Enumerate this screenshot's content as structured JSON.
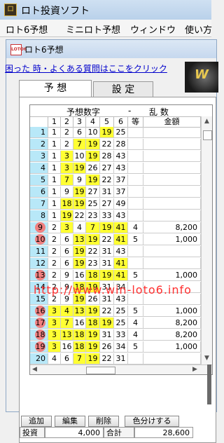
{
  "app": {
    "title": "ロト投資ソフト",
    "icon_label": "ロ"
  },
  "menu": [
    "ロト6予想",
    "ミニロト予想",
    "ウィンドウ",
    "使い方"
  ],
  "child": {
    "title": "ロト6予想",
    "icon_label": "LOTO6"
  },
  "help_link": "困った 時・よくある質問はここをクリック",
  "banner_text": "W",
  "tabs": [
    "予 想",
    "設 定"
  ],
  "grid": {
    "header_title": "予想数字",
    "header_dash": "-",
    "header_mode": "乱 数",
    "columns": [
      "",
      "1",
      "2",
      "3",
      "4",
      "5",
      "6",
      "等",
      "金額"
    ],
    "rows": [
      {
        "idx": "1",
        "n": [
          "1",
          "2",
          "6",
          "10",
          "19",
          "25"
        ],
        "hl": [
          0,
          0,
          0,
          0,
          1,
          0
        ],
        "rank": "",
        "amount": "",
        "circle": false
      },
      {
        "idx": "2",
        "n": [
          "1",
          "2",
          "7",
          "19",
          "22",
          "28"
        ],
        "hl": [
          0,
          0,
          1,
          1,
          0,
          0
        ],
        "rank": "",
        "amount": "",
        "circle": false
      },
      {
        "idx": "3",
        "n": [
          "1",
          "3",
          "10",
          "19",
          "28",
          "43"
        ],
        "hl": [
          0,
          1,
          0,
          1,
          0,
          0
        ],
        "rank": "",
        "amount": "",
        "circle": false
      },
      {
        "idx": "4",
        "n": [
          "1",
          "3",
          "19",
          "26",
          "27",
          "43"
        ],
        "hl": [
          0,
          1,
          1,
          0,
          0,
          0
        ],
        "rank": "",
        "amount": "",
        "circle": false
      },
      {
        "idx": "5",
        "n": [
          "1",
          "7",
          "9",
          "19",
          "22",
          "37"
        ],
        "hl": [
          0,
          1,
          0,
          1,
          0,
          0
        ],
        "rank": "",
        "amount": "",
        "circle": false
      },
      {
        "idx": "6",
        "n": [
          "1",
          "9",
          "19",
          "27",
          "31",
          "37"
        ],
        "hl": [
          0,
          0,
          1,
          0,
          0,
          0
        ],
        "rank": "",
        "amount": "",
        "circle": false
      },
      {
        "idx": "7",
        "n": [
          "1",
          "18",
          "19",
          "25",
          "27",
          "49"
        ],
        "hl": [
          0,
          1,
          1,
          0,
          0,
          0
        ],
        "rank": "",
        "amount": "",
        "circle": false
      },
      {
        "idx": "8",
        "n": [
          "1",
          "19",
          "22",
          "23",
          "33",
          "43"
        ],
        "hl": [
          0,
          1,
          0,
          0,
          0,
          0
        ],
        "rank": "",
        "amount": "",
        "circle": false
      },
      {
        "idx": "9",
        "n": [
          "2",
          "3",
          "4",
          "7",
          "19",
          "41"
        ],
        "hl": [
          0,
          1,
          0,
          1,
          1,
          1
        ],
        "rank": "4",
        "amount": "8,200",
        "circle": true
      },
      {
        "idx": "10",
        "n": [
          "2",
          "6",
          "13",
          "19",
          "22",
          "41"
        ],
        "hl": [
          0,
          0,
          1,
          1,
          0,
          1
        ],
        "rank": "5",
        "amount": "1,000",
        "circle": true
      },
      {
        "idx": "11",
        "n": [
          "2",
          "6",
          "19",
          "22",
          "31",
          "43"
        ],
        "hl": [
          0,
          0,
          1,
          0,
          0,
          0
        ],
        "rank": "",
        "amount": "",
        "circle": false
      },
      {
        "idx": "12",
        "n": [
          "2",
          "6",
          "19",
          "23",
          "31",
          "41"
        ],
        "hl": [
          0,
          0,
          1,
          0,
          0,
          1
        ],
        "rank": "",
        "amount": "",
        "circle": false
      },
      {
        "idx": "13",
        "n": [
          "2",
          "9",
          "16",
          "18",
          "19",
          "41"
        ],
        "hl": [
          0,
          0,
          0,
          1,
          1,
          1
        ],
        "rank": "5",
        "amount": "1,000",
        "circle": true
      },
      {
        "idx": "14",
        "n": [
          "2",
          "9",
          "18",
          "19",
          "31",
          "34"
        ],
        "hl": [
          0,
          0,
          1,
          1,
          0,
          0
        ],
        "rank": "",
        "amount": "",
        "circle": false
      },
      {
        "idx": "15",
        "n": [
          "2",
          "9",
          "19",
          "26",
          "31",
          "43"
        ],
        "hl": [
          0,
          0,
          1,
          0,
          0,
          0
        ],
        "rank": "",
        "amount": "",
        "circle": false
      },
      {
        "idx": "16",
        "n": [
          "3",
          "4",
          "13",
          "19",
          "22",
          "25"
        ],
        "hl": [
          1,
          1,
          1,
          1,
          0,
          0
        ],
        "rank": "5",
        "amount": "1,000",
        "circle": true
      },
      {
        "idx": "17",
        "n": [
          "3",
          "7",
          "16",
          "18",
          "19",
          "25"
        ],
        "hl": [
          1,
          1,
          0,
          1,
          1,
          0
        ],
        "rank": "4",
        "amount": "8,200",
        "circle": true
      },
      {
        "idx": "18",
        "n": [
          "3",
          "13",
          "18",
          "19",
          "31",
          "33"
        ],
        "hl": [
          1,
          1,
          1,
          1,
          0,
          0
        ],
        "rank": "4",
        "amount": "8,200",
        "circle": true
      },
      {
        "idx": "19",
        "n": [
          "3",
          "16",
          "18",
          "19",
          "26",
          "34"
        ],
        "hl": [
          1,
          0,
          1,
          1,
          0,
          0
        ],
        "rank": "5",
        "amount": "1,000",
        "circle": true
      },
      {
        "idx": "20",
        "n": [
          "4",
          "6",
          "7",
          "19",
          "22",
          "31"
        ],
        "hl": [
          0,
          0,
          1,
          1,
          0,
          0
        ],
        "rank": "",
        "amount": "",
        "circle": false
      }
    ]
  },
  "watermark": "http://www.win-loto6.info",
  "buttons": [
    "追加",
    "編集",
    "削除",
    "色分けする"
  ],
  "summary": {
    "invest_label": "投資",
    "invest_value": "4,000",
    "total_label": "合計",
    "total_value": "28,600"
  }
}
